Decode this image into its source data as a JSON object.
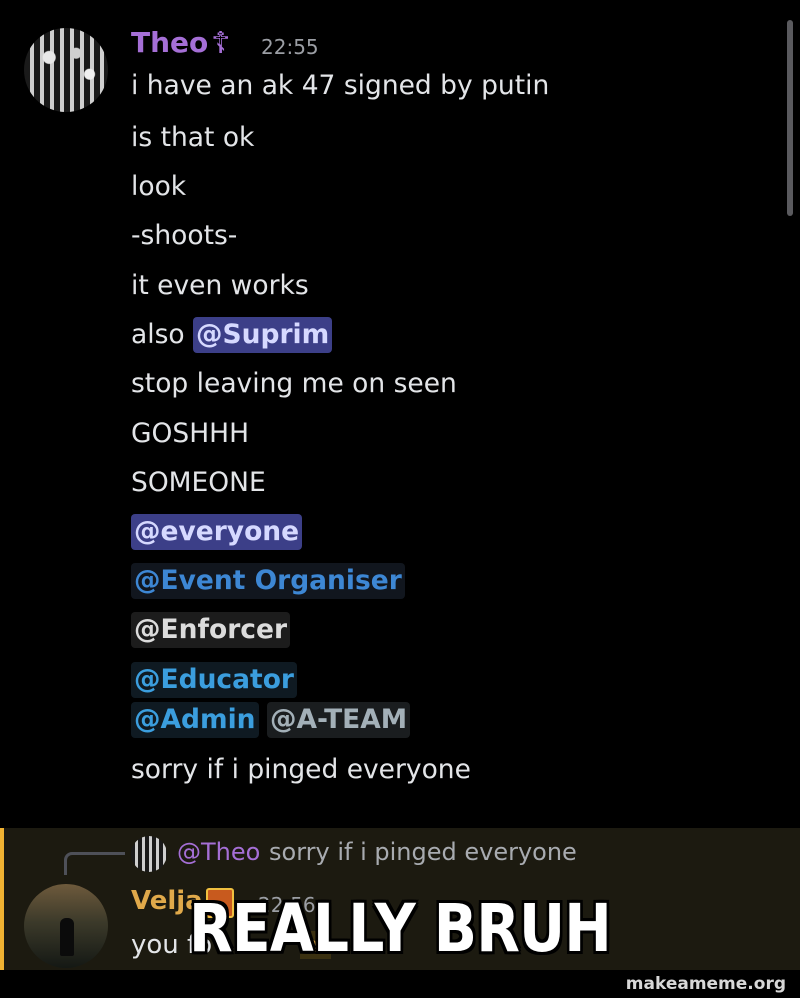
{
  "theo": {
    "username": "Theo",
    "role_icon": "orthodox-cross-icon",
    "role_icon_glyph": "☦",
    "timestamp": "22:55",
    "messages": {
      "m1": "i have an ak 47 signed by putin",
      "m2": "is that ok",
      "m3": "look",
      "m4": "-shoots-",
      "m5": "it even works",
      "m6_prefix": "also ",
      "m6_mention": "@Suprim",
      "m7": "stop leaving me on seen",
      "m8": "GOSHHH",
      "m9": "SOMEONE",
      "m10": "@everyone",
      "m11": "@Event Organiser",
      "m12": "@Enforcer",
      "m13": "@Educator",
      "m14a": "@Admin",
      "m14b": "@A-TEAM",
      "m15": "sorry if i pinged everyone"
    }
  },
  "reply": {
    "mention": "@Theo",
    "text": "sorry if i pinged everyone"
  },
  "velja": {
    "username": "Velja",
    "badge_icon": "server-badge-icon",
    "timestamp": "22:56",
    "message_visible": "you fo",
    "message_obscured": "nt"
  },
  "meme": {
    "caption": "REALLY BRUH",
    "watermark": "makeameme.org"
  },
  "colors": {
    "background": "#000000",
    "theo_name": "#a56fd6",
    "velja_name": "#e0a94a",
    "mention_blurple": "#3c3f88",
    "highlight_bar": "#f0b232"
  }
}
